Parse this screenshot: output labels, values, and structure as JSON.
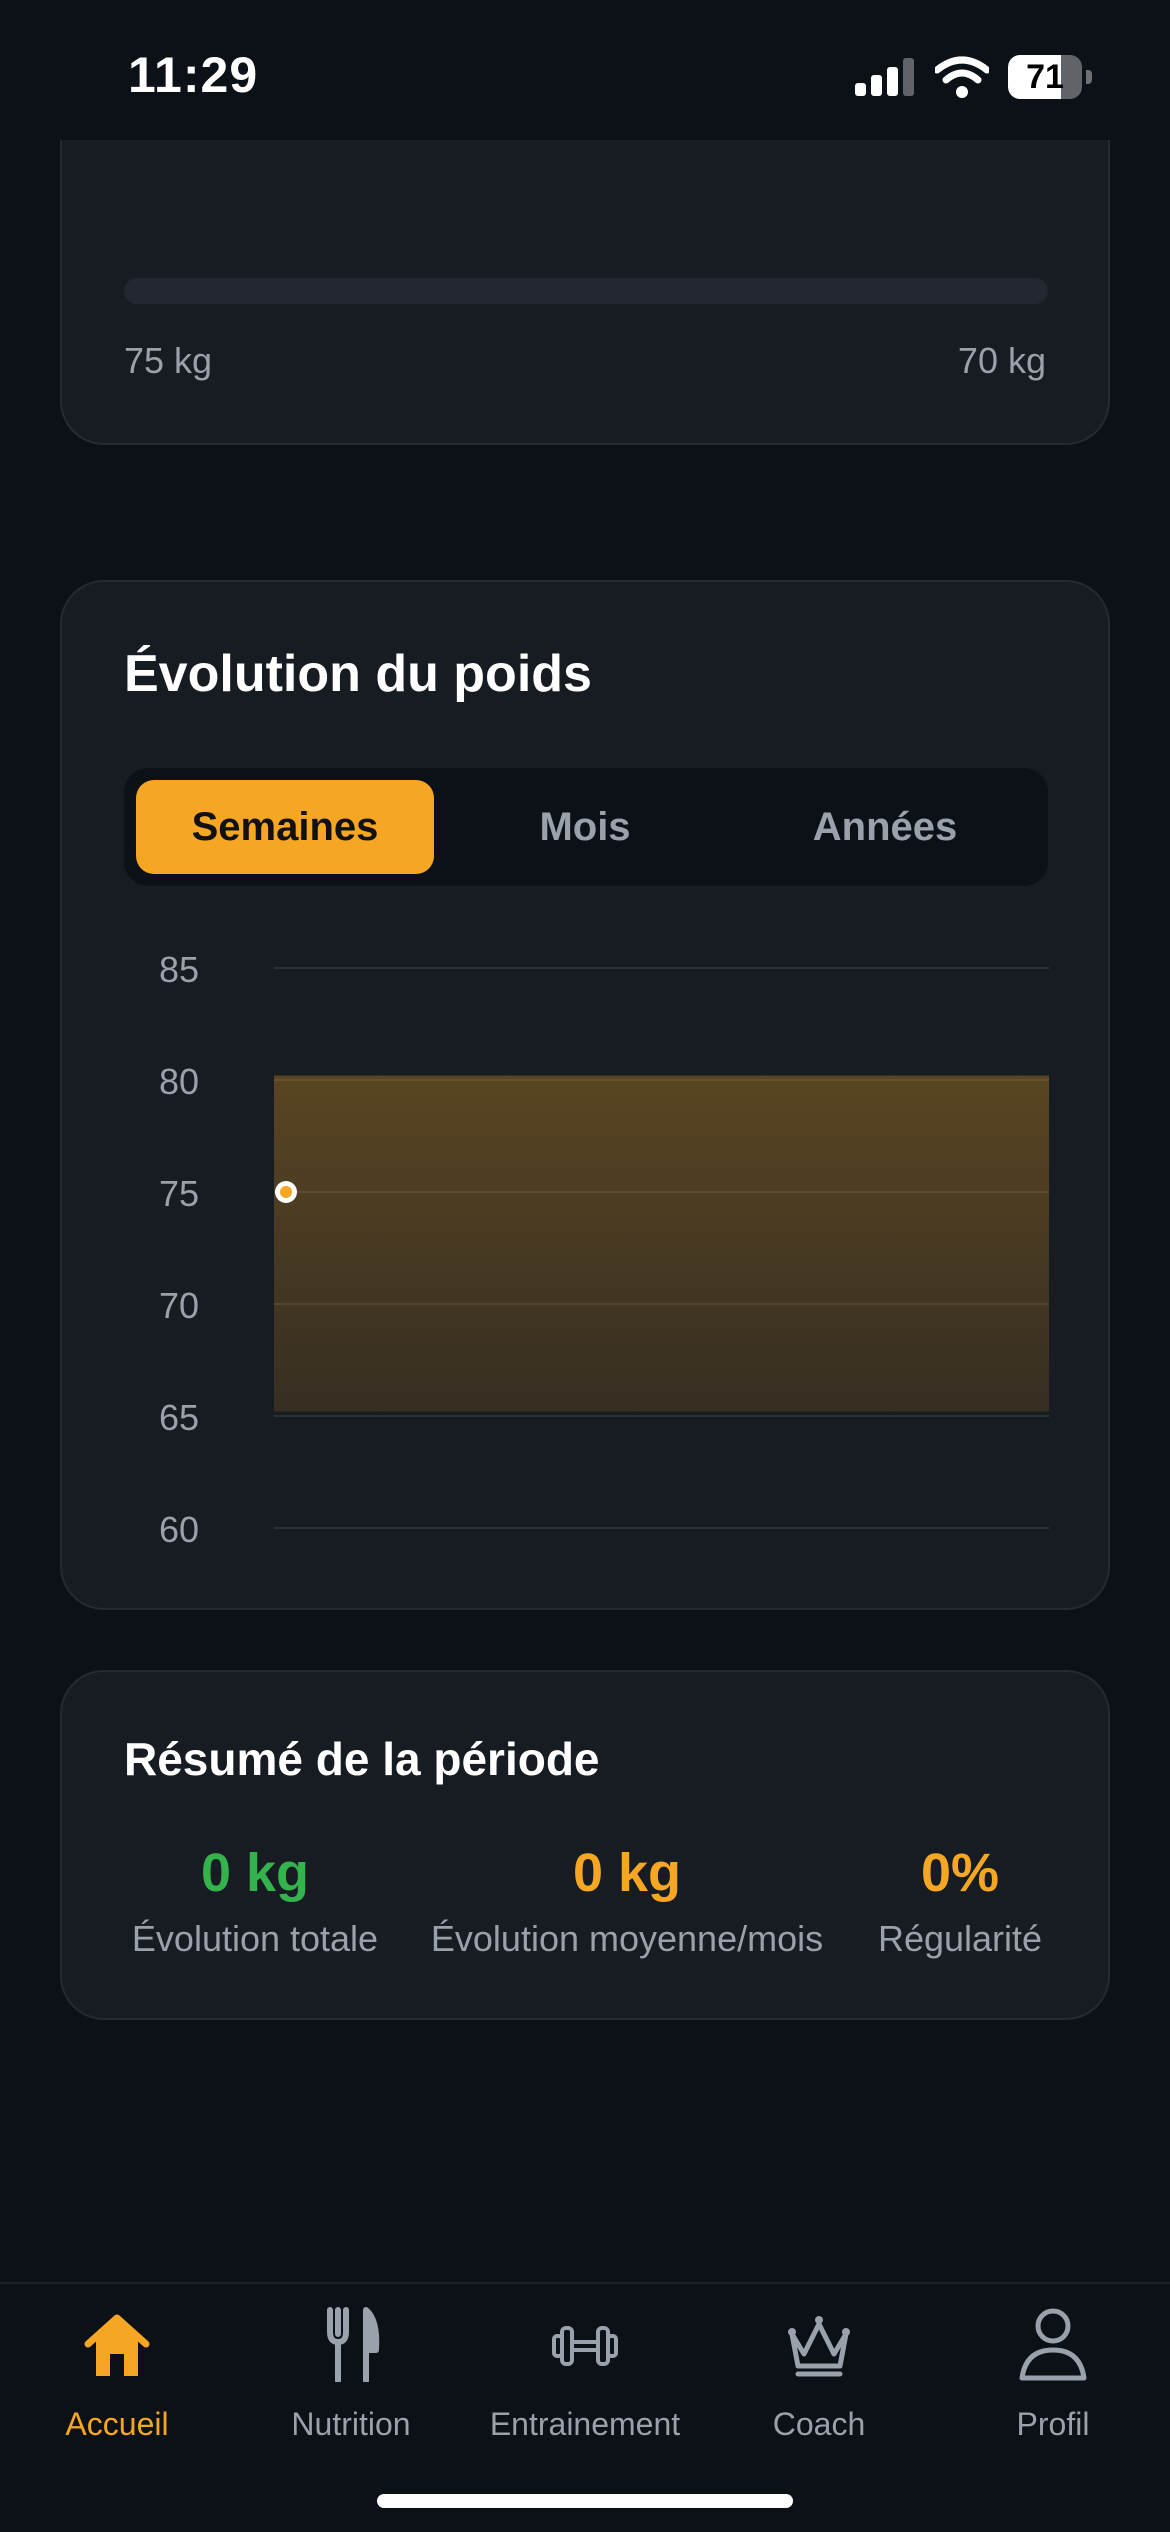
{
  "status_bar": {
    "time": "11:29",
    "battery": "71",
    "battery_level": 0.71
  },
  "goal_card": {
    "start_label": "75 kg",
    "target_label": "70 kg",
    "progress": 0
  },
  "weight_chart": {
    "title": "Évolution du poids",
    "tabs": [
      "Semaines",
      "Mois",
      "Années"
    ],
    "active_tab": "Semaines"
  },
  "chart_data": {
    "type": "area",
    "y_ticks": [
      "85",
      "80",
      "75",
      "70",
      "65",
      "60"
    ],
    "ylim": [
      60,
      85
    ],
    "band": {
      "from": 65.2,
      "to": 80.2
    },
    "points": [
      {
        "x": 0,
        "y": 75
      }
    ],
    "grid": true,
    "accent": "#f5a623"
  },
  "summary": {
    "title": "Résumé de la période",
    "stats": [
      {
        "value": "0 kg",
        "label": "Évolution totale",
        "color": "#34b24c"
      },
      {
        "value": "0 kg",
        "label": "Évolution moyenne/mois",
        "color": "#f5a623"
      },
      {
        "value": "0%",
        "label": "Régularité",
        "color": "#f5a623"
      }
    ]
  },
  "tab_bar": {
    "items": [
      {
        "label": "Accueil",
        "icon": "home-icon"
      },
      {
        "label": "Nutrition",
        "icon": "fork-knife-icon"
      },
      {
        "label": "Entrainement",
        "icon": "dumbbell-icon"
      },
      {
        "label": "Coach",
        "icon": "crown-icon"
      },
      {
        "label": "Profil",
        "icon": "person-icon"
      }
    ],
    "active": "Accueil"
  },
  "colors": {
    "accent": "#f5a623",
    "positive": "#34b24c",
    "background": "#0c1017",
    "card": "#171b22",
    "muted": "#9ba1ab"
  }
}
